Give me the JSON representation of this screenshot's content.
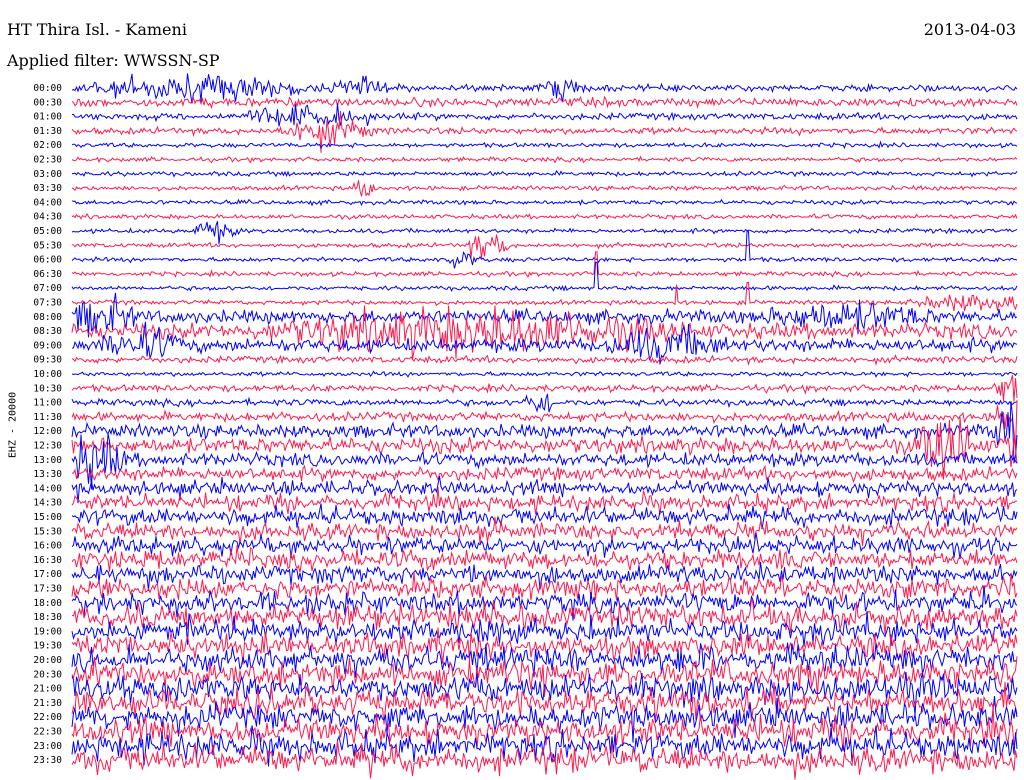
{
  "header": {
    "station": "HT Thira Isl. - Kameni",
    "date": "2013-04-03",
    "filter": "Applied filter: WWSSN-SP"
  },
  "channel_label": "EHZ - 20000",
  "chart_data": {
    "type": "helicorder",
    "title": "HT Thira Isl. - Kameni",
    "date": "2013-04-03",
    "filter": "WWSSN-SP",
    "ylabel": "EHZ - 20000",
    "line_labels": [
      "00:00",
      "00:30",
      "01:00",
      "01:30",
      "02:00",
      "02:30",
      "03:00",
      "03:30",
      "04:00",
      "04:30",
      "05:00",
      "05:30",
      "06:00",
      "06:30",
      "07:00",
      "07:30",
      "08:00",
      "08:30",
      "09:00",
      "09:30",
      "10:00",
      "10:30",
      "11:00",
      "11:30",
      "12:00",
      "12:30",
      "13:00",
      "13:30",
      "14:00",
      "14:30",
      "15:00",
      "15:30",
      "16:00",
      "16:30",
      "17:00",
      "17:30",
      "18:00",
      "18:30",
      "19:00",
      "19:30",
      "20:00",
      "20:30",
      "21:00",
      "21:30",
      "22:00",
      "22:30",
      "23:00",
      "23:30"
    ],
    "colors": [
      "#0000ff",
      "#ff1a4d"
    ],
    "noise_amplitude": [
      3,
      4,
      3,
      3,
      2,
      2,
      2,
      2,
      2,
      2,
      2,
      2,
      2,
      2,
      2,
      2,
      6,
      7,
      6,
      3,
      2,
      3,
      3,
      4,
      6,
      7,
      6,
      6,
      7,
      7,
      8,
      8,
      8,
      9,
      9,
      10,
      10,
      11,
      11,
      11,
      12,
      12,
      12,
      12,
      12,
      12,
      12,
      12
    ],
    "events": [
      {
        "line": "00:00",
        "t": 0.03,
        "amp": 10,
        "dur": 0.2
      },
      {
        "line": "00:00",
        "t": 0.28,
        "amp": 8,
        "dur": 0.05
      },
      {
        "line": "00:00",
        "t": 0.5,
        "amp": 8,
        "dur": 0.04
      },
      {
        "line": "01:00",
        "t": 0.19,
        "amp": 8,
        "dur": 0.12
      },
      {
        "line": "01:30",
        "t": 0.23,
        "amp": 12,
        "dur": 0.08
      },
      {
        "line": "03:30",
        "t": 0.3,
        "amp": 8,
        "dur": 0.02
      },
      {
        "line": "05:00",
        "t": 0.13,
        "amp": 9,
        "dur": 0.04
      },
      {
        "line": "05:30",
        "t": 0.42,
        "amp": 12,
        "dur": 0.04
      },
      {
        "line": "06:00",
        "t": 0.39,
        "amp": 6,
        "dur": 0.04
      },
      {
        "line": "07:30",
        "t": 0.9,
        "amp": 7,
        "dur": 0.12
      },
      {
        "line": "08:00",
        "t": 0.0,
        "amp": 14,
        "dur": 0.06
      },
      {
        "line": "08:00",
        "t": 0.75,
        "amp": 10,
        "dur": 0.14
      },
      {
        "line": "08:30",
        "t": 0.25,
        "amp": 16,
        "dur": 0.35
      },
      {
        "line": "09:00",
        "t": 0.04,
        "amp": 12,
        "dur": 0.07
      },
      {
        "line": "09:00",
        "t": 0.58,
        "amp": 12,
        "dur": 0.1
      },
      {
        "line": "10:30",
        "t": 0.98,
        "amp": 14,
        "dur": 0.03
      },
      {
        "line": "11:00",
        "t": 0.48,
        "amp": 10,
        "dur": 0.03
      },
      {
        "line": "11:30",
        "t": 0.98,
        "amp": 26,
        "dur": 0.03
      },
      {
        "line": "12:00",
        "t": 0.98,
        "amp": 28,
        "dur": 0.03
      },
      {
        "line": "12:30",
        "t": 0.9,
        "amp": 28,
        "dur": 0.05
      },
      {
        "line": "12:30",
        "t": 0.99,
        "amp": 30,
        "dur": 0.02
      },
      {
        "line": "13:00",
        "t": 0.0,
        "amp": 20,
        "dur": 0.05
      }
    ],
    "spikes": [
      {
        "line": "06:30",
        "t": 0.555,
        "height": 22
      },
      {
        "line": "07:00",
        "t": 0.555,
        "height": 26
      },
      {
        "line": "06:00",
        "t": 0.715,
        "height": 28
      },
      {
        "line": "07:30",
        "t": 0.715,
        "height": 20
      },
      {
        "line": "07:30",
        "t": 0.64,
        "height": 18
      }
    ]
  }
}
